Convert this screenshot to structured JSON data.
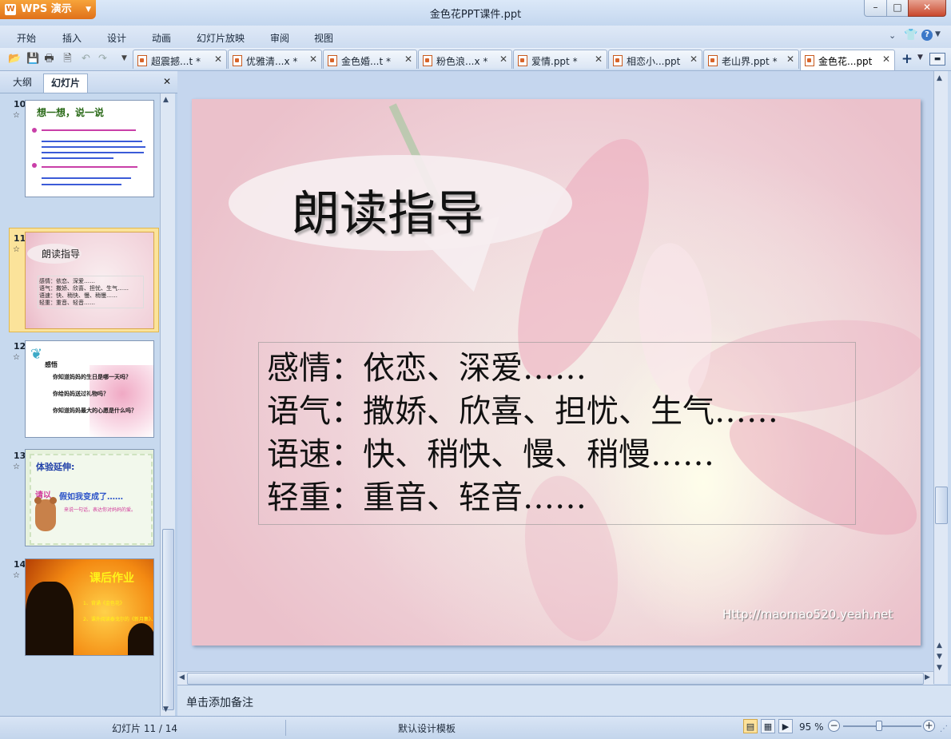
{
  "window": {
    "app_button": "WPS 演示",
    "title": "金色花PPT课件.ppt",
    "controls": {
      "minimize": "–",
      "maximize": "□",
      "close": "✕"
    }
  },
  "menu": [
    "开始",
    "插入",
    "设计",
    "动画",
    "幻灯片放映",
    "审阅",
    "视图"
  ],
  "tabs": [
    {
      "label": "超震撼...t *",
      "active": false
    },
    {
      "label": "优雅清...x *",
      "active": false
    },
    {
      "label": "金色婚...t *",
      "active": false
    },
    {
      "label": "粉色浪...x *",
      "active": false
    },
    {
      "label": "爱情.ppt *",
      "active": false
    },
    {
      "label": "相恋小...ppt",
      "active": false
    },
    {
      "label": "老山界.ppt *",
      "active": false
    },
    {
      "label": "金色花...ppt",
      "active": true
    }
  ],
  "tab_close": "✕",
  "panel": {
    "tab_outline": "大纲",
    "tab_slides": "幻灯片",
    "close": "✕"
  },
  "thumbnails": [
    {
      "number": "10",
      "title": "想一想，说一说",
      "lines": [
        "孩子变成金色花为什么没说话出来？",
        "孩子调皮、可爱的和妈妈天然处，与母亲的感情是纯洁清澈的。",
        "妈妈问孩子，为什么还一直…",
        "妈妈找到了孩子，多么着急，一直见了，又恢复完全，自然得到孩子。"
      ]
    },
    {
      "number": "11",
      "title": "朗读指导",
      "lines": [
        "感情：依恋、深爱……",
        "语气：撒娇、欣喜、担忧、生气……",
        "语速：快、稍快、慢、稍慢……",
        "轻重：重音、轻音……"
      ]
    },
    {
      "number": "12",
      "title": "感悟",
      "lines": [
        "你知道妈妈的生日是哪一天吗？",
        "你给妈妈送过礼物吗？",
        "你知道妈妈最大的心愿是什么吗？"
      ]
    },
    {
      "number": "13",
      "title": "体验延伸:",
      "lines": [
        "假如我变成了……",
        "请以",
        "来说一句话，表达你对妈妈的爱。"
      ]
    },
    {
      "number": "14",
      "title": "课后作业",
      "lines": [
        "1、背诵《金色花》",
        "2、课外阅读泰戈尔的《新月集》、《飞鸟集》"
      ]
    }
  ],
  "slide": {
    "title": "朗读指导",
    "lines": [
      "感情：依恋、深爱……",
      "语气：撒娇、欣喜、担忧、生气……",
      "语速：快、稍快、慢、稍慢……",
      "轻重：重音、轻音……"
    ],
    "watermark": "Http://maomao520.yeah.net"
  },
  "notes_placeholder": "单击添加备注",
  "status": {
    "slide_indicator": "幻灯片 11 / 14",
    "template": "默认设计模板",
    "zoom": "95 %",
    "zoom_level_percent": 95
  },
  "colors": {
    "wps_orange": "#f08a24",
    "selection": "#fbe39a",
    "panel_bg": "#c7d9ee"
  }
}
